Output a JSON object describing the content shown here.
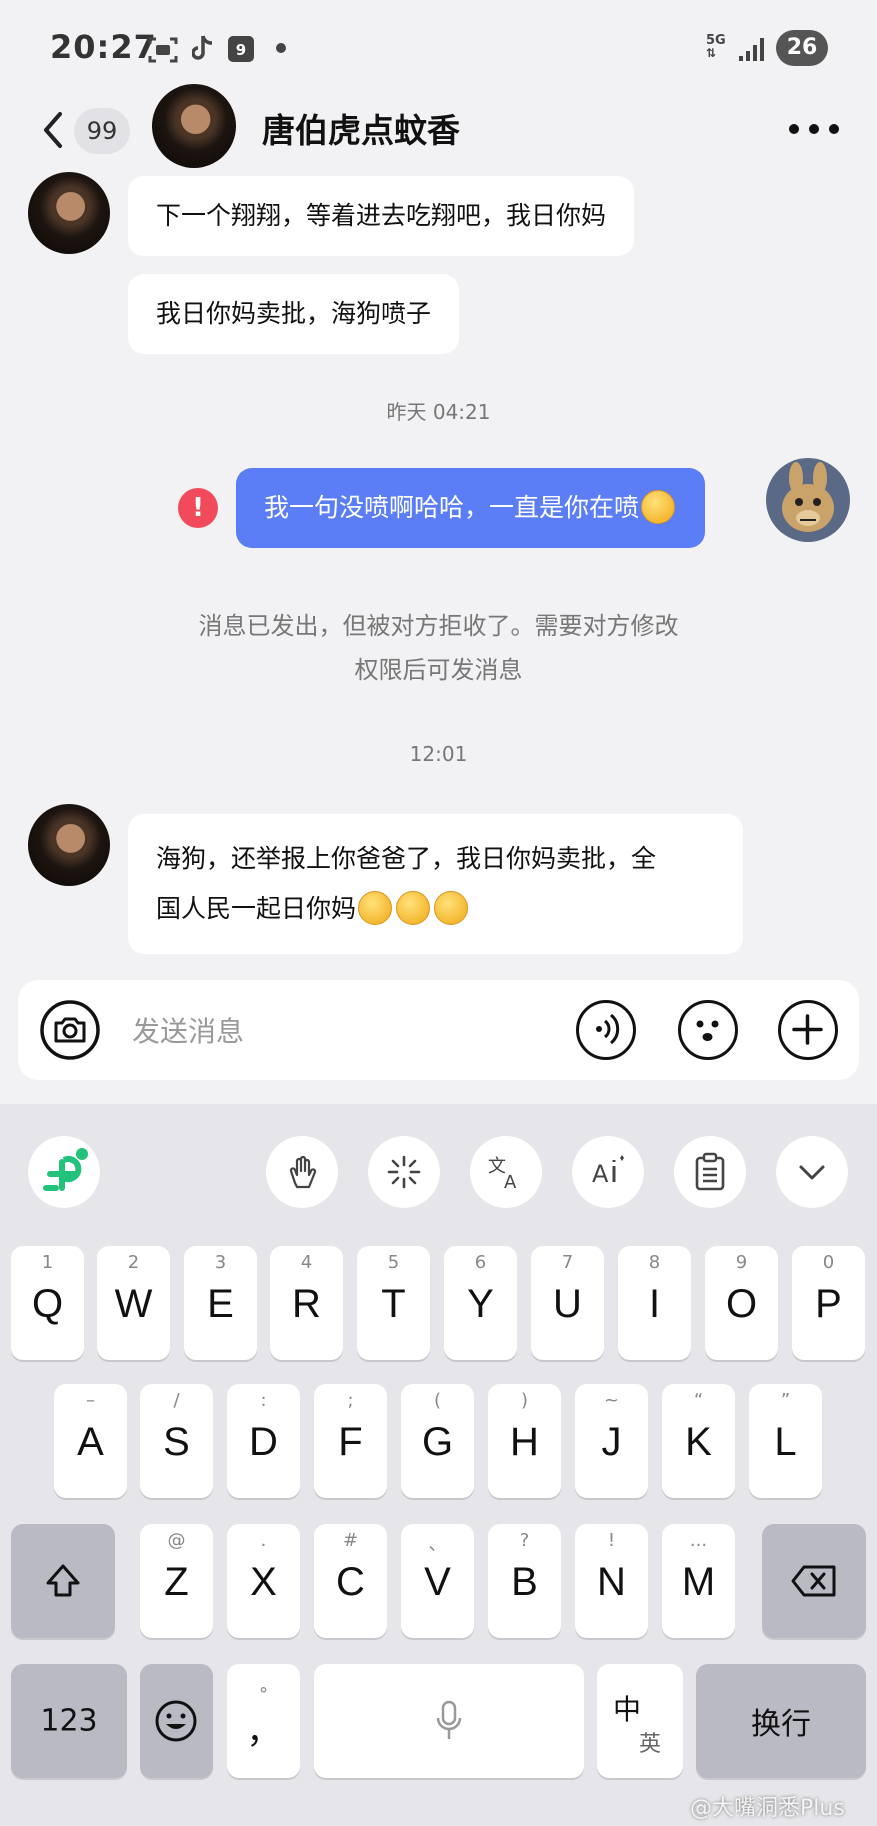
{
  "status_bar": {
    "time": "20:27",
    "calendar_day": "9",
    "network": "5G",
    "battery": "26"
  },
  "header": {
    "back_count": "99",
    "title": "唐伯虎点蚊香"
  },
  "messages": [
    {
      "sender": "other",
      "text": "下一个翔翔，等着进去吃翔吧，我日你妈"
    },
    {
      "sender": "other",
      "text": "我日你妈卖批，海狗喷子"
    },
    {
      "type": "time",
      "text": "昨天 04:21"
    },
    {
      "sender": "me",
      "text": "我一句没喷啊哈哈，一直是你在喷",
      "status": "failed"
    },
    {
      "type": "system",
      "line1": "消息已发出，但被对方拒收了。需要对方修改",
      "line2": "权限后可发消息"
    },
    {
      "type": "time",
      "text": "12:01"
    },
    {
      "sender": "other",
      "line1": "海狗，还举报上你爸爸了，我日你妈卖批，全",
      "line2": "国人民一起日你妈"
    }
  ],
  "input_bar": {
    "placeholder": "发送消息"
  },
  "keyboard": {
    "row1": [
      {
        "hint": "1",
        "key": "Q"
      },
      {
        "hint": "2",
        "key": "W"
      },
      {
        "hint": "3",
        "key": "E"
      },
      {
        "hint": "4",
        "key": "R"
      },
      {
        "hint": "5",
        "key": "T"
      },
      {
        "hint": "6",
        "key": "Y"
      },
      {
        "hint": "7",
        "key": "U"
      },
      {
        "hint": "8",
        "key": "I"
      },
      {
        "hint": "9",
        "key": "O"
      },
      {
        "hint": "0",
        "key": "P"
      }
    ],
    "row2": [
      {
        "hint": "–",
        "key": "A"
      },
      {
        "hint": "/",
        "key": "S"
      },
      {
        "hint": ":",
        "key": "D"
      },
      {
        "hint": ";",
        "key": "F"
      },
      {
        "hint": "(",
        "key": "G"
      },
      {
        "hint": ")",
        "key": "H"
      },
      {
        "hint": "~",
        "key": "J"
      },
      {
        "hint": "“",
        "key": "K"
      },
      {
        "hint": "”",
        "key": "L"
      }
    ],
    "row3": [
      {
        "hint": "@",
        "key": "Z"
      },
      {
        "hint": ".",
        "key": "X"
      },
      {
        "hint": "#",
        "key": "C"
      },
      {
        "hint": "、",
        "key": "V"
      },
      {
        "hint": "?",
        "key": "B"
      },
      {
        "hint": "!",
        "key": "N"
      },
      {
        "hint": "...",
        "key": "M"
      }
    ],
    "num_key": "123",
    "comma_key": "，",
    "comma_hint": "°",
    "lang_top": "中",
    "lang_bottom": "英",
    "enter_key": "换行"
  },
  "watermark": "@大嘴洞悉Plus",
  "colors": {
    "my_bubble": "#5b7df6",
    "error": "#f04a5b",
    "keyboard_logo": "#21c27a"
  }
}
